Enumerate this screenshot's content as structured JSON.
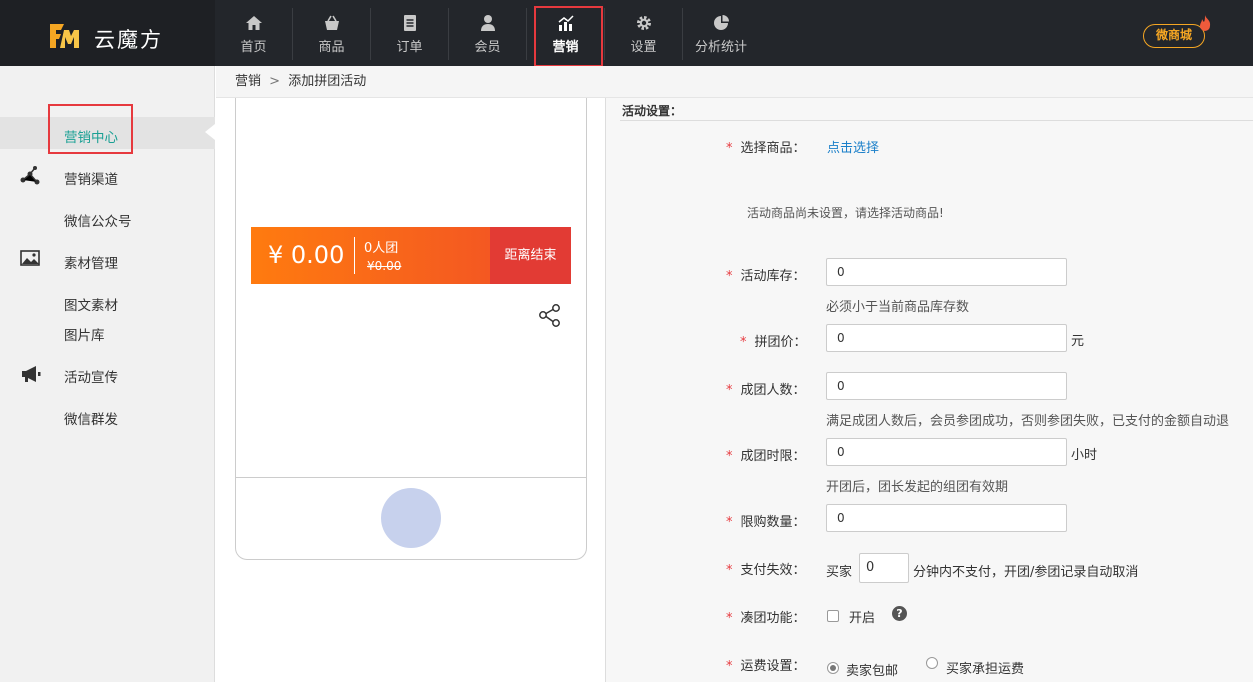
{
  "app": {
    "name": "云魔方",
    "store_badge": "微商城"
  },
  "nav": [
    {
      "label": "首页",
      "icon": "home-icon"
    },
    {
      "label": "商品",
      "icon": "basket-icon"
    },
    {
      "label": "订单",
      "icon": "document-icon"
    },
    {
      "label": "会员",
      "icon": "user-icon"
    },
    {
      "label": "营销",
      "icon": "chart-icon",
      "active": true
    },
    {
      "label": "设置",
      "icon": "gear-icon"
    },
    {
      "label": "分析统计",
      "icon": "pie-icon"
    }
  ],
  "sidebar": {
    "items": [
      {
        "label": "营销中心",
        "active": true
      },
      {
        "label": "营销渠道",
        "icon": "share-nodes-icon"
      },
      {
        "label": "微信公众号"
      },
      {
        "label": "素材管理",
        "icon": "image-icon"
      },
      {
        "label": "图文素材"
      },
      {
        "label": "图片库"
      },
      {
        "label": "活动宣传",
        "icon": "megaphone-icon"
      },
      {
        "label": "微信群发"
      }
    ]
  },
  "breadcrumb": {
    "parent": "营销",
    "separator": ">",
    "current": "添加拼团活动"
  },
  "preview": {
    "price": "¥ 0.00",
    "group_size": "0人团",
    "original_price": "¥0.00",
    "countdown_label": "距离结束"
  },
  "form": {
    "section_title": "活动设置：",
    "product": {
      "label": "选择商品：",
      "link": "点击选择",
      "notice": "活动商品尚未设置，请选择活动商品!"
    },
    "stock": {
      "label": "活动库存：",
      "value": "0",
      "help": "必须小于当前商品库存数"
    },
    "group_price": {
      "label": "拼团价：",
      "value": "0",
      "unit": "元"
    },
    "group_count": {
      "label": "成团人数：",
      "value": "0",
      "help": "满足成团人数后，会员参团成功，否则参团失败，已支付的金额自动退"
    },
    "time_limit": {
      "label": "成团时限：",
      "value": "0",
      "unit": "小时",
      "help": "开团后，团长发起的组团有效期"
    },
    "purchase_limit": {
      "label": "限购数量：",
      "value": "0"
    },
    "payment_timeout": {
      "label": "支付失效：",
      "prefix": "买家",
      "value": "0",
      "suffix": "分钟内不支付，开团/参团记录自动取消"
    },
    "auto_group": {
      "label": "凑团功能：",
      "option": "开启",
      "help_icon": "?"
    },
    "shipping": {
      "label": "运费设置：",
      "option1": "卖家包邮",
      "option2": "买家承担运费"
    }
  },
  "colors": {
    "accent": "#1aa094",
    "topbar": "#23262b",
    "highlight": "#e6393e",
    "badge": "#f5a623"
  }
}
